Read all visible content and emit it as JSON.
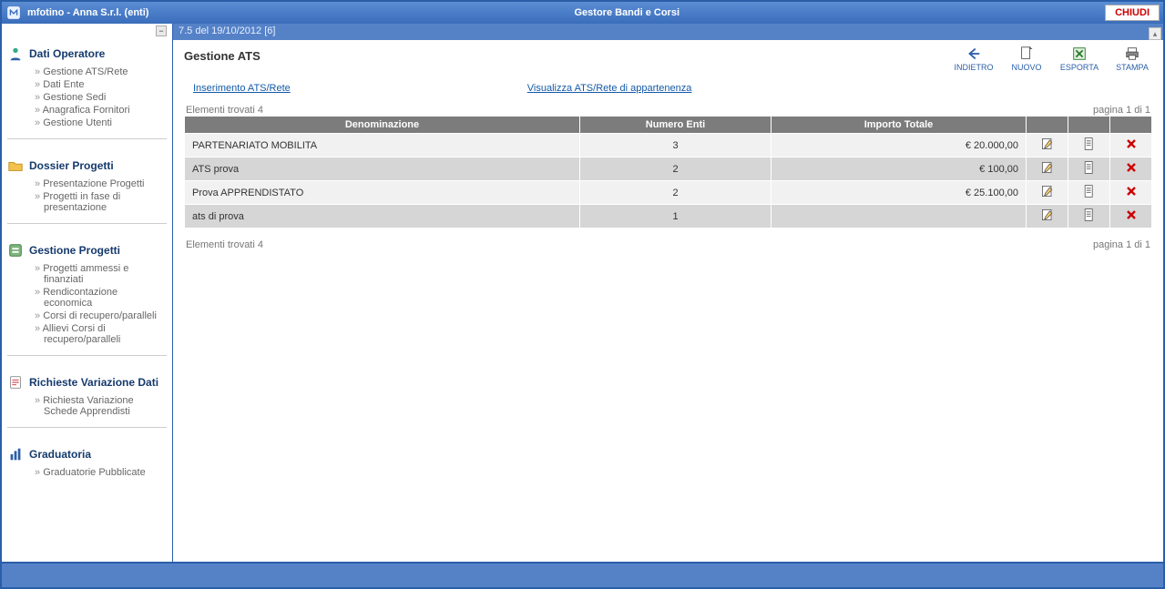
{
  "header": {
    "user_title": "mfotino - Anna S.r.l. (enti)",
    "app_title": "Gestore Bandi e Corsi",
    "close_label": "CHIUDI"
  },
  "version": "7.5 del 19/10/2012 [6]",
  "sidebar": {
    "sections": [
      {
        "title": "Dati Operatore",
        "items": [
          "Gestione ATS/Rete",
          "Dati Ente",
          "Gestione Sedi",
          "Anagrafica Fornitori",
          "Gestione Utenti"
        ]
      },
      {
        "title": "Dossier Progetti",
        "items": [
          "Presentazione Progetti",
          "Progetti in fase di presentazione"
        ]
      },
      {
        "title": "Gestione Progetti",
        "items": [
          "Progetti ammessi e finanziati",
          "Rendicontazione economica",
          "Corsi di recupero/paralleli",
          "Allievi Corsi di recupero/paralleli"
        ]
      },
      {
        "title": "Richieste Variazione Dati",
        "items": [
          "Richiesta Variazione Schede Apprendisti"
        ]
      },
      {
        "title": "Graduatoria",
        "items": [
          "Graduatorie Pubblicate"
        ]
      }
    ]
  },
  "page": {
    "title": "Gestione ATS",
    "toolbar": {
      "back": "INDIETRO",
      "new": "NUOVO",
      "export": "ESPORTA",
      "print": "STAMPA"
    },
    "tabs": {
      "insert": "Inserimento ATS/Rete",
      "view": "Visualizza ATS/Rete di appartenenza"
    },
    "found_top": "Elementi trovati 4",
    "page_top": "pagina 1 di 1",
    "found_bottom": "Elementi trovati 4",
    "page_bottom": "pagina 1 di 1"
  },
  "table": {
    "columns": [
      "Denominazione",
      "Numero Enti",
      "Importo Totale"
    ],
    "rows": [
      {
        "denominazione": "PARTENARIATO MOBILITA",
        "numero": "3",
        "importo": "€ 20.000,00"
      },
      {
        "denominazione": "ATS prova",
        "numero": "2",
        "importo": "€ 100,00"
      },
      {
        "denominazione": "Prova APPRENDISTATO",
        "numero": "2",
        "importo": "€ 25.100,00"
      },
      {
        "denominazione": "ats di prova",
        "numero": "1",
        "importo": ""
      }
    ]
  }
}
